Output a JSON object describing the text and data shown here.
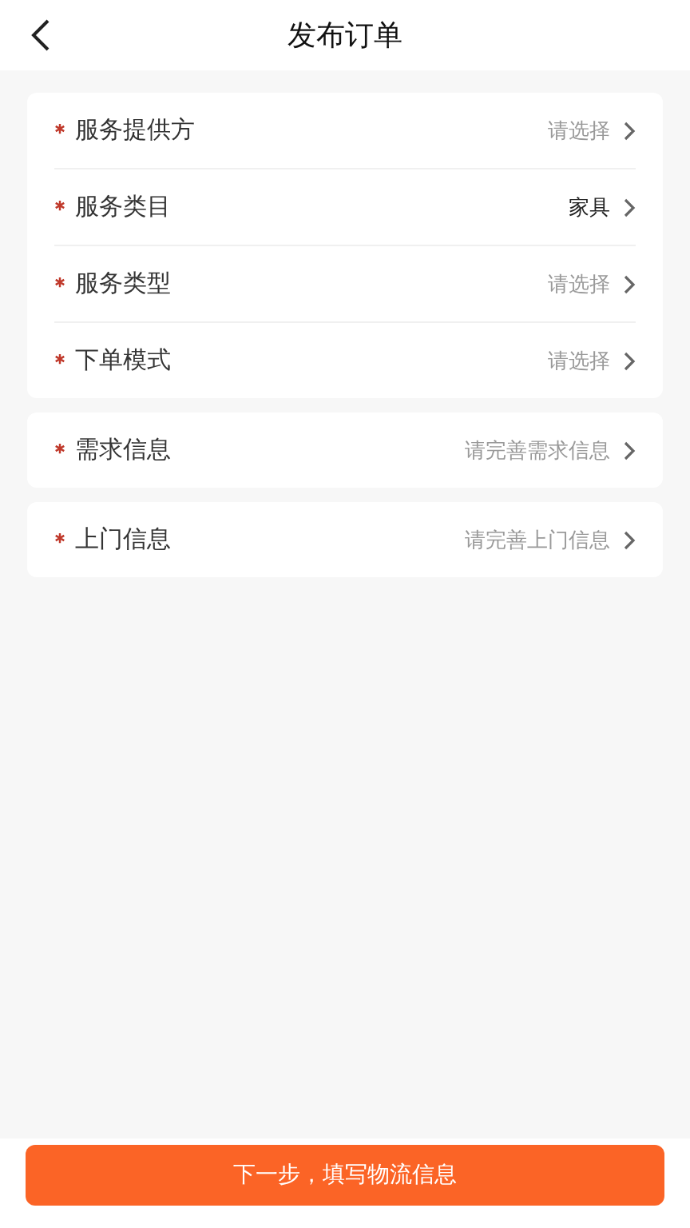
{
  "header": {
    "title": "发布订单"
  },
  "groups": [
    {
      "rows": [
        {
          "label": "服务提供方",
          "required": true,
          "placeholder": "请选择"
        },
        {
          "label": "服务类目",
          "required": true,
          "value": "家具"
        },
        {
          "label": "服务类型",
          "required": true,
          "placeholder": "请选择"
        },
        {
          "label": "下单模式",
          "required": true,
          "placeholder": "请选择"
        }
      ]
    },
    {
      "rows": [
        {
          "label": "需求信息",
          "required": true,
          "placeholder": "请完善需求信息"
        }
      ]
    },
    {
      "rows": [
        {
          "label": "上门信息",
          "required": true,
          "placeholder": "请完善上门信息"
        }
      ]
    }
  ],
  "submit": {
    "label": "下一步，填写物流信息"
  }
}
